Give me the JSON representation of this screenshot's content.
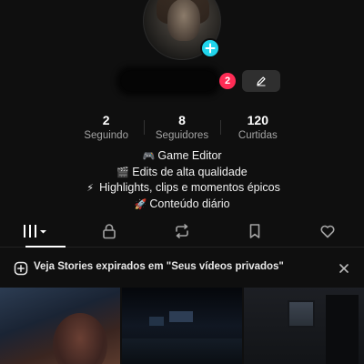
{
  "profile": {
    "notification_count": "2",
    "avatar_icon": "avatar",
    "add_icon": "plus-icon",
    "edit_icon": "pencil-icon"
  },
  "stats": [
    {
      "value": "2",
      "label": "Seguindo"
    },
    {
      "value": "8",
      "label": "Seguidores"
    },
    {
      "value": "120",
      "label": "Curtidas"
    }
  ],
  "bio": [
    {
      "emoji": "🎮",
      "text": "Game Editor"
    },
    {
      "emoji": "🎬",
      "text": "Edits de alta qualidade"
    },
    {
      "emoji": "⚡",
      "text": "Highlights, clips e momentos épicos"
    },
    {
      "emoji": "🚀",
      "text": "Conteúdo diário"
    }
  ],
  "tabs": [
    {
      "icon": "videos-grid-icon",
      "active": true
    },
    {
      "icon": "lock-icon",
      "active": false
    },
    {
      "icon": "repost-icon",
      "active": false
    },
    {
      "icon": "bookmark-icon",
      "active": false
    },
    {
      "icon": "heart-icon",
      "active": false
    }
  ],
  "banner": {
    "text": "Veja Stories expirados em \"Seus vídeos privados\"",
    "icon": "plus-circle-icon",
    "close_icon": "close-icon"
  },
  "colors": {
    "background": "#0f0f0f",
    "accent_cyan": "#20d5ec",
    "badge_red": "#fe2c55",
    "muted_text": "#a4a4a4"
  }
}
